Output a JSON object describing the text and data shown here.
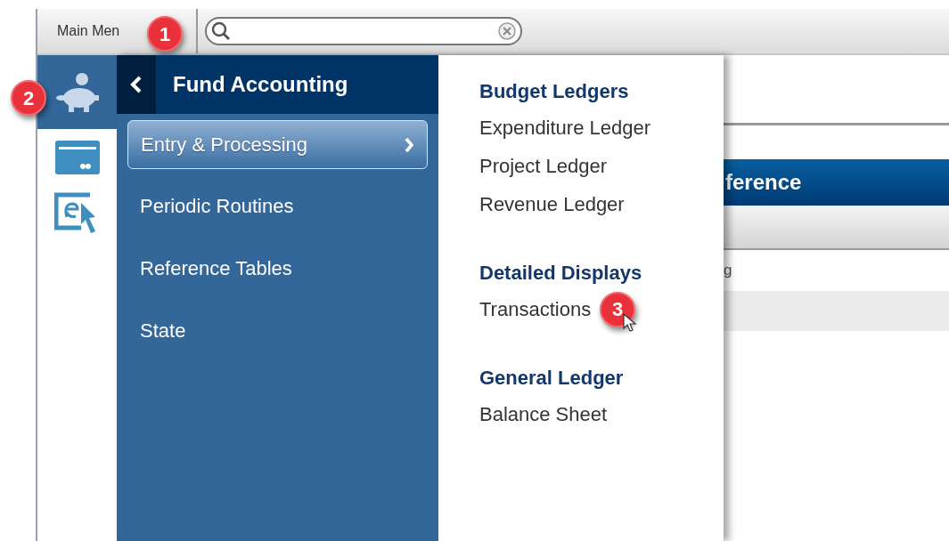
{
  "toolbar": {
    "main_menu_label": "Main Men",
    "callout": "1"
  },
  "icon_rail": {
    "callout": "2",
    "items": [
      {
        "kind": "piggy",
        "selected": true
      },
      {
        "kind": "card",
        "selected": false
      },
      {
        "kind": "cursor",
        "selected": false
      }
    ]
  },
  "nav": {
    "title": "Fund Accounting",
    "items": [
      {
        "label": "Entry & Processing",
        "selected": true
      },
      {
        "label": "Periodic Routines",
        "selected": false
      },
      {
        "label": "Reference Tables",
        "selected": false
      },
      {
        "label": "State",
        "selected": false
      }
    ]
  },
  "submenu": {
    "groups": [
      {
        "heading": "Budget Ledgers",
        "items": [
          {
            "label": "Expenditure Ledger"
          },
          {
            "label": "Project Ledger"
          },
          {
            "label": "Revenue Ledger"
          }
        ]
      },
      {
        "heading": "Detailed Displays",
        "items": [
          {
            "label": "Transactions",
            "callout": "3"
          }
        ]
      },
      {
        "heading": "General Ledger",
        "items": [
          {
            "label": "Balance Sheet"
          }
        ]
      }
    ]
  },
  "background": {
    "panel_header": "ference",
    "row_text": "g"
  }
}
